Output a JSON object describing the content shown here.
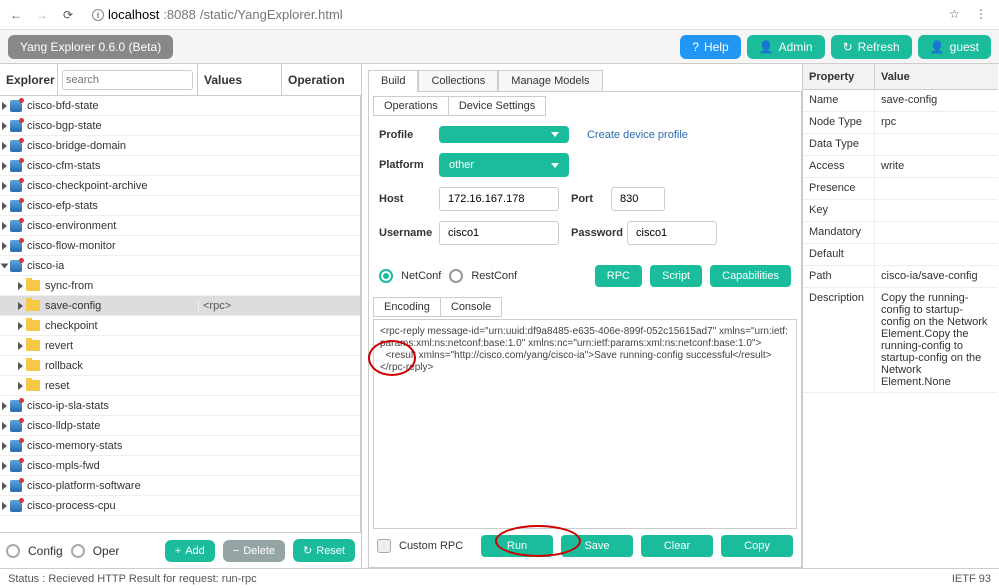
{
  "browser": {
    "url_host": "localhost",
    "url_port": ":8088",
    "url_path": "/static/YangExplorer.html"
  },
  "app_version": "Yang Explorer 0.6.0 (Beta)",
  "top_buttons": {
    "help": "Help",
    "admin": "Admin",
    "refresh": "Refresh",
    "guest": "guest"
  },
  "left_header": {
    "explorer": "Explorer",
    "search_placeholder": "search",
    "values": "Values",
    "operation": "Operation"
  },
  "tree": [
    {
      "name": "cisco-bfd-state",
      "icon": "module",
      "level": 0
    },
    {
      "name": "cisco-bgp-state",
      "icon": "module",
      "level": 0
    },
    {
      "name": "cisco-bridge-domain",
      "icon": "module",
      "level": 0
    },
    {
      "name": "cisco-cfm-stats",
      "icon": "module",
      "level": 0
    },
    {
      "name": "cisco-checkpoint-archive",
      "icon": "module",
      "level": 0
    },
    {
      "name": "cisco-efp-stats",
      "icon": "module",
      "level": 0
    },
    {
      "name": "cisco-environment",
      "icon": "module",
      "level": 0
    },
    {
      "name": "cisco-flow-monitor",
      "icon": "module",
      "level": 0
    },
    {
      "name": "cisco-ia",
      "icon": "module",
      "level": 0,
      "open": true
    },
    {
      "name": "sync-from",
      "icon": "folder",
      "level": 1
    },
    {
      "name": "save-config",
      "icon": "folder",
      "level": 1,
      "value": "<rpc>",
      "selected": true
    },
    {
      "name": "checkpoint",
      "icon": "folder",
      "level": 1
    },
    {
      "name": "revert",
      "icon": "folder",
      "level": 1
    },
    {
      "name": "rollback",
      "icon": "folder",
      "level": 1
    },
    {
      "name": "reset",
      "icon": "folder",
      "level": 1
    },
    {
      "name": "cisco-ip-sla-stats",
      "icon": "module",
      "level": 0
    },
    {
      "name": "cisco-lldp-state",
      "icon": "module",
      "level": 0
    },
    {
      "name": "cisco-memory-stats",
      "icon": "module",
      "level": 0
    },
    {
      "name": "cisco-mpls-fwd",
      "icon": "module",
      "level": 0
    },
    {
      "name": "cisco-platform-software",
      "icon": "module",
      "level": 0
    },
    {
      "name": "cisco-process-cpu",
      "icon": "module",
      "level": 0
    }
  ],
  "left_footer": {
    "config": "Config",
    "oper": "Oper",
    "add": "Add",
    "delete": "Delete",
    "reset": "Reset"
  },
  "mid": {
    "tabs": {
      "build": "Build",
      "collections": "Collections",
      "manage": "Manage Models"
    },
    "subtabs": {
      "operations": "Operations",
      "device": "Device Settings"
    },
    "form": {
      "profile_label": "Profile",
      "profile_value": "",
      "create_profile": "Create device profile",
      "platform_label": "Platform",
      "platform_value": "other",
      "host_label": "Host",
      "host_value": "172.16.167.178",
      "port_label": "Port",
      "port_value": "830",
      "username_label": "Username",
      "username_value": "cisco1",
      "password_label": "Password",
      "password_value": "cisco1"
    },
    "proto": {
      "netconf": "NetConf",
      "restconf": "RestConf",
      "rpc": "RPC",
      "script": "Script",
      "caps": "Capabilities"
    },
    "enc_tabs": {
      "encoding": "Encoding",
      "console": "Console"
    },
    "xml": "<rpc-reply message-id=\"urn:uuid:df9a8485-e635-406e-899f-052c15615ad7\" xmlns=\"urn:ietf:params:xml:ns:netconf:base:1.0\" xmlns:nc=\"urn:ietf:params:xml:ns:netconf:base:1.0\">\n  <result xmlns=\"http://cisco.com/yang/cisco-ia\">Save running-config successful</result>\n</rpc-reply>",
    "bottom": {
      "custom": "Custom RPC",
      "run": "Run",
      "save": "Save",
      "clear": "Clear",
      "copy": "Copy"
    }
  },
  "right": {
    "header": {
      "prop": "Property",
      "val": "Value"
    },
    "rows": [
      {
        "k": "Name",
        "v": "save-config"
      },
      {
        "k": "Node Type",
        "v": "rpc"
      },
      {
        "k": "Data Type",
        "v": ""
      },
      {
        "k": "Access",
        "v": "write"
      },
      {
        "k": "Presence",
        "v": ""
      },
      {
        "k": "Key",
        "v": ""
      },
      {
        "k": "Mandatory",
        "v": ""
      },
      {
        "k": "Default",
        "v": ""
      },
      {
        "k": "Path",
        "v": "cisco-ia/save-config"
      },
      {
        "k": "Description",
        "v": "Copy the running-config to startup-config on the Network Element.Copy the running-config to startup-config on the Network Element.None"
      }
    ]
  },
  "status": {
    "text": "Status : Recieved HTTP Result for request: run-rpc",
    "right": "IETF 93"
  }
}
